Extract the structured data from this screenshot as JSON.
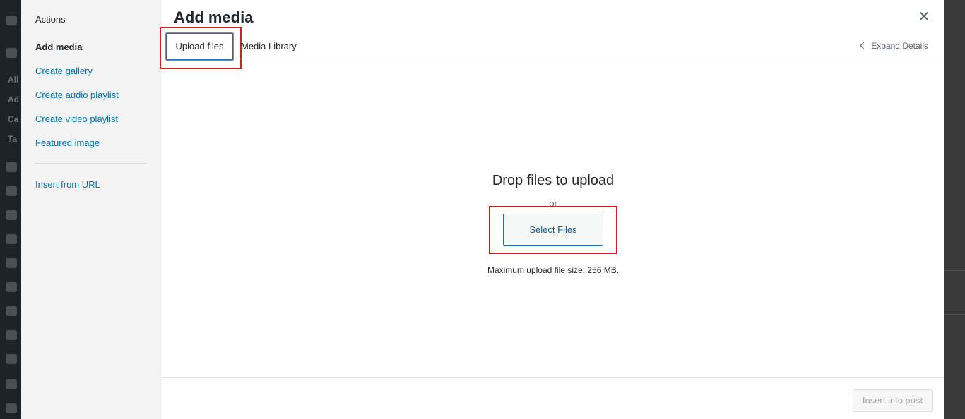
{
  "admin_menu": {
    "labels": [
      "All",
      "Ad",
      "Ca",
      "Ta"
    ]
  },
  "menu": {
    "heading": "Actions",
    "items": [
      {
        "label": "Add media",
        "active": true
      },
      {
        "label": "Create gallery"
      },
      {
        "label": "Create audio playlist"
      },
      {
        "label": "Create video playlist"
      },
      {
        "label": "Featured image"
      },
      {
        "label": "Insert from URL"
      }
    ]
  },
  "header": {
    "title": "Add media",
    "close_icon": "close-icon"
  },
  "router": {
    "tabs": [
      {
        "label": "Upload files",
        "active": true
      },
      {
        "label": "Media Library"
      }
    ],
    "expand_label": "Expand Details"
  },
  "uploader": {
    "drop_title": "Drop files to upload",
    "or": "or",
    "select_button": "Select Files",
    "max_size": "Maximum upload file size: 256 MB."
  },
  "toolbar": {
    "insert_button": "Insert into post"
  },
  "colors": {
    "accent": "#0073aa",
    "highlight": "#d0201f"
  }
}
